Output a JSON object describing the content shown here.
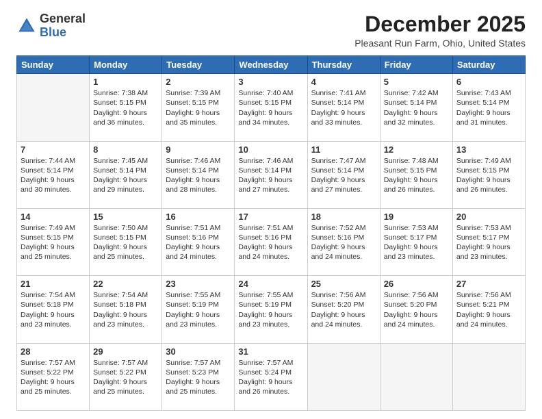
{
  "header": {
    "logo_general": "General",
    "logo_blue": "Blue",
    "month_title": "December 2025",
    "location": "Pleasant Run Farm, Ohio, United States"
  },
  "days_of_week": [
    "Sunday",
    "Monday",
    "Tuesday",
    "Wednesday",
    "Thursday",
    "Friday",
    "Saturday"
  ],
  "weeks": [
    [
      {
        "day": "",
        "info": ""
      },
      {
        "day": "1",
        "info": "Sunrise: 7:38 AM\nSunset: 5:15 PM\nDaylight: 9 hours\nand 36 minutes."
      },
      {
        "day": "2",
        "info": "Sunrise: 7:39 AM\nSunset: 5:15 PM\nDaylight: 9 hours\nand 35 minutes."
      },
      {
        "day": "3",
        "info": "Sunrise: 7:40 AM\nSunset: 5:15 PM\nDaylight: 9 hours\nand 34 minutes."
      },
      {
        "day": "4",
        "info": "Sunrise: 7:41 AM\nSunset: 5:14 PM\nDaylight: 9 hours\nand 33 minutes."
      },
      {
        "day": "5",
        "info": "Sunrise: 7:42 AM\nSunset: 5:14 PM\nDaylight: 9 hours\nand 32 minutes."
      },
      {
        "day": "6",
        "info": "Sunrise: 7:43 AM\nSunset: 5:14 PM\nDaylight: 9 hours\nand 31 minutes."
      }
    ],
    [
      {
        "day": "7",
        "info": "Sunrise: 7:44 AM\nSunset: 5:14 PM\nDaylight: 9 hours\nand 30 minutes."
      },
      {
        "day": "8",
        "info": "Sunrise: 7:45 AM\nSunset: 5:14 PM\nDaylight: 9 hours\nand 29 minutes."
      },
      {
        "day": "9",
        "info": "Sunrise: 7:46 AM\nSunset: 5:14 PM\nDaylight: 9 hours\nand 28 minutes."
      },
      {
        "day": "10",
        "info": "Sunrise: 7:46 AM\nSunset: 5:14 PM\nDaylight: 9 hours\nand 27 minutes."
      },
      {
        "day": "11",
        "info": "Sunrise: 7:47 AM\nSunset: 5:14 PM\nDaylight: 9 hours\nand 27 minutes."
      },
      {
        "day": "12",
        "info": "Sunrise: 7:48 AM\nSunset: 5:15 PM\nDaylight: 9 hours\nand 26 minutes."
      },
      {
        "day": "13",
        "info": "Sunrise: 7:49 AM\nSunset: 5:15 PM\nDaylight: 9 hours\nand 26 minutes."
      }
    ],
    [
      {
        "day": "14",
        "info": "Sunrise: 7:49 AM\nSunset: 5:15 PM\nDaylight: 9 hours\nand 25 minutes."
      },
      {
        "day": "15",
        "info": "Sunrise: 7:50 AM\nSunset: 5:15 PM\nDaylight: 9 hours\nand 25 minutes."
      },
      {
        "day": "16",
        "info": "Sunrise: 7:51 AM\nSunset: 5:16 PM\nDaylight: 9 hours\nand 24 minutes."
      },
      {
        "day": "17",
        "info": "Sunrise: 7:51 AM\nSunset: 5:16 PM\nDaylight: 9 hours\nand 24 minutes."
      },
      {
        "day": "18",
        "info": "Sunrise: 7:52 AM\nSunset: 5:16 PM\nDaylight: 9 hours\nand 24 minutes."
      },
      {
        "day": "19",
        "info": "Sunrise: 7:53 AM\nSunset: 5:17 PM\nDaylight: 9 hours\nand 23 minutes."
      },
      {
        "day": "20",
        "info": "Sunrise: 7:53 AM\nSunset: 5:17 PM\nDaylight: 9 hours\nand 23 minutes."
      }
    ],
    [
      {
        "day": "21",
        "info": "Sunrise: 7:54 AM\nSunset: 5:18 PM\nDaylight: 9 hours\nand 23 minutes."
      },
      {
        "day": "22",
        "info": "Sunrise: 7:54 AM\nSunset: 5:18 PM\nDaylight: 9 hours\nand 23 minutes."
      },
      {
        "day": "23",
        "info": "Sunrise: 7:55 AM\nSunset: 5:19 PM\nDaylight: 9 hours\nand 23 minutes."
      },
      {
        "day": "24",
        "info": "Sunrise: 7:55 AM\nSunset: 5:19 PM\nDaylight: 9 hours\nand 23 minutes."
      },
      {
        "day": "25",
        "info": "Sunrise: 7:56 AM\nSunset: 5:20 PM\nDaylight: 9 hours\nand 24 minutes."
      },
      {
        "day": "26",
        "info": "Sunrise: 7:56 AM\nSunset: 5:20 PM\nDaylight: 9 hours\nand 24 minutes."
      },
      {
        "day": "27",
        "info": "Sunrise: 7:56 AM\nSunset: 5:21 PM\nDaylight: 9 hours\nand 24 minutes."
      }
    ],
    [
      {
        "day": "28",
        "info": "Sunrise: 7:57 AM\nSunset: 5:22 PM\nDaylight: 9 hours\nand 25 minutes."
      },
      {
        "day": "29",
        "info": "Sunrise: 7:57 AM\nSunset: 5:22 PM\nDaylight: 9 hours\nand 25 minutes."
      },
      {
        "day": "30",
        "info": "Sunrise: 7:57 AM\nSunset: 5:23 PM\nDaylight: 9 hours\nand 25 minutes."
      },
      {
        "day": "31",
        "info": "Sunrise: 7:57 AM\nSunset: 5:24 PM\nDaylight: 9 hours\nand 26 minutes."
      },
      {
        "day": "",
        "info": ""
      },
      {
        "day": "",
        "info": ""
      },
      {
        "day": "",
        "info": ""
      }
    ]
  ]
}
